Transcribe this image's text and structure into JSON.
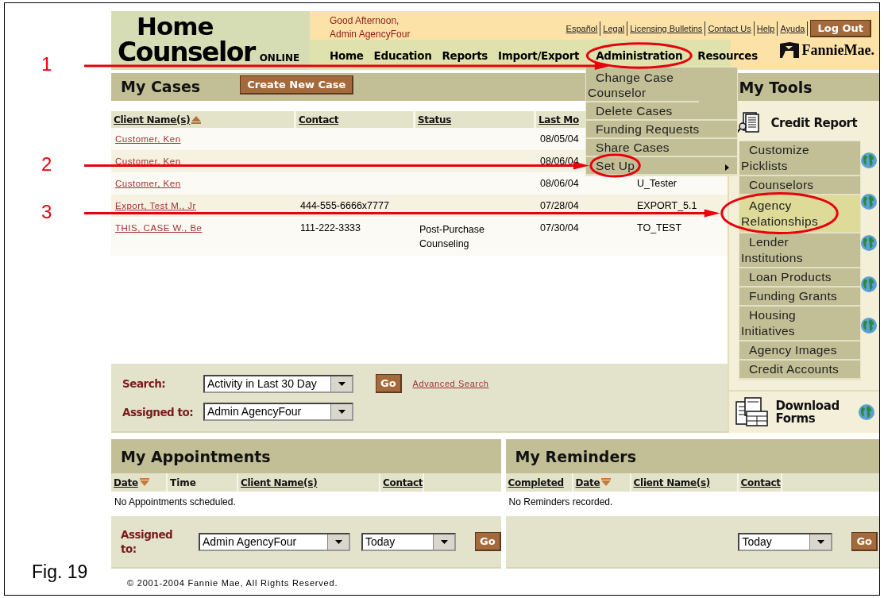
{
  "header": {
    "logo": {
      "line_1": "Home",
      "line_2": "Counselor",
      "suffix": "ONLINE"
    },
    "greeting": [
      "Good Afternoon,",
      "Admin AgencyFour"
    ],
    "top_links": [
      "Español",
      "Legal",
      "Licensing Bulletins",
      "Contact Us",
      "Help",
      "Ayuda"
    ],
    "logout": "Log Out",
    "brand": "FannieMae.",
    "nav": [
      "Home",
      "Education",
      "Reports",
      "Import/Export",
      "Administration",
      "Resources"
    ]
  },
  "admin_menu": {
    "items": [
      {
        "label": "Change Case Counselor",
        "submenu": false
      },
      {
        "label": "Delete Cases",
        "submenu": false
      },
      {
        "label": "Funding Requests",
        "submenu": false
      },
      {
        "label": "Share Cases",
        "submenu": false
      },
      {
        "label": "Set Up",
        "submenu": true
      }
    ]
  },
  "setup_submenu": {
    "items": [
      {
        "label": "Customize Picklists",
        "selected": false
      },
      {
        "label": "Counselors",
        "selected": false
      },
      {
        "label": "Agency Relationships",
        "selected": true
      },
      {
        "label": "Lender Institutions",
        "selected": false
      },
      {
        "label": "Loan Products",
        "selected": false
      },
      {
        "label": "Funding Grants",
        "selected": false
      },
      {
        "label": "Housing Initiatives",
        "selected": false
      },
      {
        "label": "Agency Images",
        "selected": false
      },
      {
        "label": "Credit Accounts",
        "selected": false
      }
    ]
  },
  "cases": {
    "title": "My Cases",
    "create_button": "Create New Case",
    "columns": [
      {
        "label": "Client Name(s)",
        "sort_ascending": true
      },
      {
        "label": "Contact"
      },
      {
        "label": "Status"
      },
      {
        "label": "Last Mo"
      }
    ],
    "rows": [
      {
        "client": "Customer, Ken",
        "last_modified": "08/05/04"
      },
      {
        "client": "Customer, Ken",
        "last_modified": "08/06/04"
      },
      {
        "client": "Customer, Ken",
        "last_modified": "08/06/04",
        "column_5": "U_Tester"
      },
      {
        "client": "Export, Test M., Jr",
        "contact": "444-555-6666x7777",
        "last_modified": "07/28/04",
        "column_5": "EXPORT_5.1"
      },
      {
        "client": "THIS, CASE W., Be",
        "contact": "111-222-3333",
        "status": "Post-Purchase Counseling",
        "last_modified": "07/30/04",
        "column_5": "TO_TEST"
      }
    ]
  },
  "search": {
    "label": "Search:",
    "value": "Activity in Last 30 Day",
    "go": "Go",
    "advanced": "Advanced Search",
    "assigned_label": "Assigned to:",
    "assigned_value": "Admin AgencyFour"
  },
  "tools": {
    "title": "My Tools",
    "items": [
      {
        "label": "Credit Report",
        "kind": "credit"
      },
      {
        "label": "Download Forms",
        "kind": "forms"
      }
    ]
  },
  "appointments": {
    "title": "My Appointments",
    "columns": [
      {
        "label": "Date",
        "link": true,
        "sort_descending": true
      },
      {
        "label": "Time",
        "link": false
      },
      {
        "label": "Client Name(s)",
        "link": true
      },
      {
        "label": "Contact",
        "link": true
      }
    ],
    "empty": "No Appointments scheduled.",
    "assigned_label": "Assigned to:",
    "assigned_value": "Admin AgencyFour",
    "period": "Today",
    "go": "Go"
  },
  "reminders": {
    "title": "My Reminders",
    "columns": [
      {
        "label": "Completed",
        "link": true
      },
      {
        "label": "Date",
        "link": true,
        "sort_descending": true
      },
      {
        "label": "Client Name(s)",
        "link": true
      },
      {
        "label": "Contact",
        "link": true
      }
    ],
    "empty": "No Reminders recorded.",
    "period": "Today",
    "go": "Go"
  },
  "footer": "© 2001-2004 Fannie Mae, All Rights Reserved.",
  "caption": "Fig. 19",
  "annotations": [
    {
      "label": "1"
    },
    {
      "label": "2"
    },
    {
      "label": "3"
    }
  ]
}
